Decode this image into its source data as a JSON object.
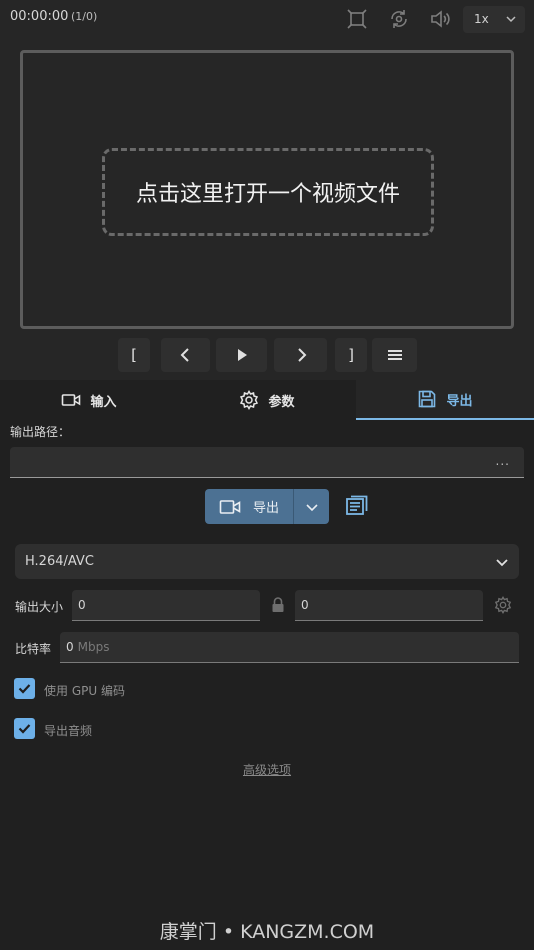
{
  "topbar": {
    "time": "00:00:00",
    "count": "(1/0)",
    "icons": [
      "fullscreen-icon",
      "sync-icon",
      "volume-icon"
    ],
    "speed": "1x"
  },
  "video": {
    "open_prompt": "点击这里打开一个视频文件"
  },
  "transport": {
    "mark_in": "[",
    "mark_out": "]",
    "icons": [
      "chevron-left-icon",
      "play-icon",
      "chevron-right-icon",
      "menu-icon"
    ]
  },
  "tabs": [
    {
      "label": "输入",
      "icon": "video-camera-icon",
      "active": false
    },
    {
      "label": "参数",
      "icon": "gear-icon",
      "active": true
    },
    {
      "label": "导出",
      "icon": "save-icon",
      "active": true
    }
  ],
  "export": {
    "path_label": "输出路径：",
    "path_value": "",
    "path_more": "...",
    "export_label": "导出",
    "codec": "H.264/AVC",
    "size_label": "输出大小",
    "width": "0",
    "height": "0",
    "bitrate_label": "比特率",
    "bitrate_value": "0",
    "bitrate_unit": "Mbps",
    "gpu_label": "使用 GPU 编码",
    "gpu_checked": true,
    "audio_label": "导出音频",
    "audio_checked": true,
    "advanced_label": "高级选项"
  },
  "watermark": "康掌门 • KANGZM.COM",
  "colors": {
    "accent": "#7cb8e6",
    "export_button": "#4c7193",
    "checkbox": "#6db0e8"
  }
}
